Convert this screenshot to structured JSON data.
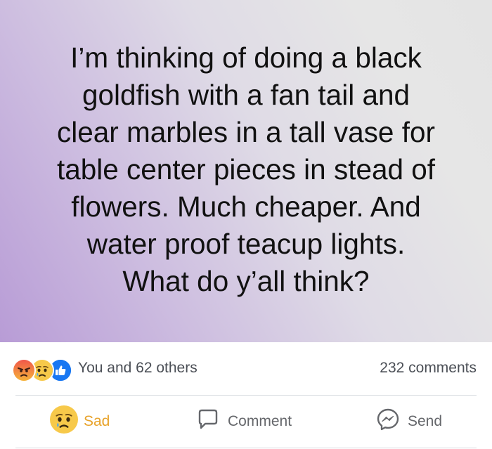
{
  "post": {
    "lines": [
      "I’m thinking of doing a black",
      "goldfish with a fan tail and",
      "clear marbles in a tall vase for",
      "table center pieces in stead of",
      "flowers. Much cheaper. And",
      "water proof teacup lights.",
      "What do y’all think?"
    ],
    "background_gradient": [
      "#b89cd6",
      "#e4e4e4"
    ]
  },
  "reactions": {
    "icons": [
      "angry-emoji-icon",
      "sad-emoji-icon",
      "like-thumb-icon"
    ],
    "summary": "You and 62 others",
    "comments_count": "232 comments"
  },
  "actions": {
    "react_label": "Sad",
    "react_color": "#e8a32b",
    "comment_label": "Comment",
    "send_label": "Send"
  },
  "colors": {
    "angry": "#f0574a",
    "sad": "#f7c94a",
    "like": "#1877f2",
    "muted_text": "#65676b"
  }
}
